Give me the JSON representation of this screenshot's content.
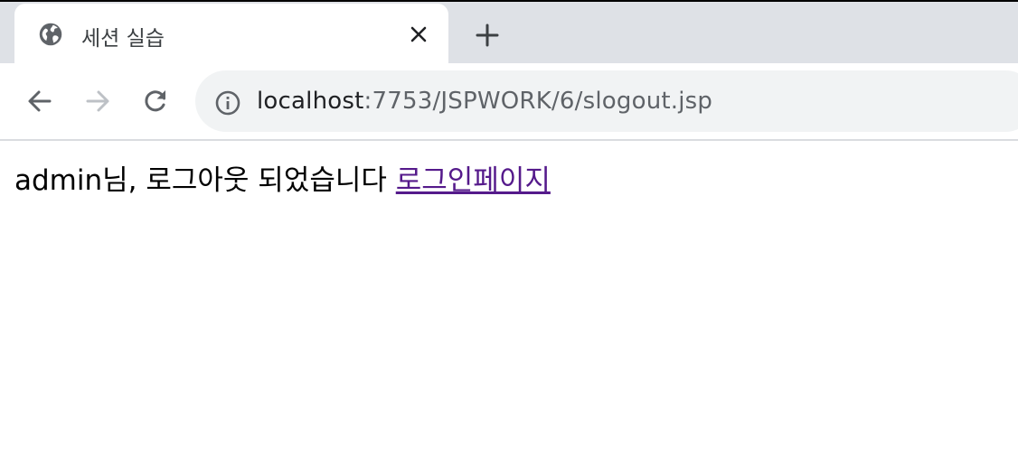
{
  "browser": {
    "tab": {
      "title": "세션 실습",
      "favicon": "globe-icon",
      "close_icon": "close-icon"
    },
    "new_tab_icon": "plus-icon",
    "nav": {
      "back_icon": "back-arrow-icon",
      "forward_icon": "forward-arrow-icon",
      "reload_icon": "reload-icon"
    },
    "address_bar": {
      "info_icon": "info-icon",
      "host": "localhost",
      "path": ":7753/JSPWORK/6/slogout.jsp"
    }
  },
  "page": {
    "message": "admin님, 로그아웃 되었습니다 ",
    "link_text": "로그인페이지"
  },
  "colors": {
    "tabstrip_bg": "#dee1e6",
    "omnibox_bg": "#f1f3f4",
    "visited_link": "#551a8b"
  }
}
